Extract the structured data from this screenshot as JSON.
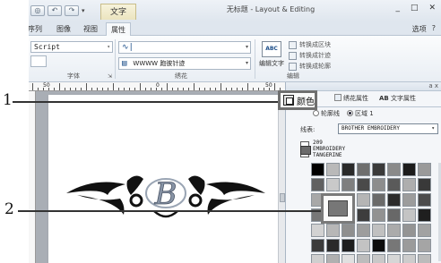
{
  "callouts": {
    "one": "1",
    "two": "2"
  },
  "title_bar": {
    "contextual_tab": "文字",
    "title": "无标题 - Layout & Editing",
    "minimize": "_",
    "maximize": "□",
    "close": "✕",
    "dropdown": "▾"
  },
  "tabs": {
    "items": [
      "序列",
      "图像",
      "视图",
      "属性"
    ],
    "right": [
      "选项",
      "?"
    ]
  },
  "ribbon": {
    "font_name": "Script",
    "font_group": "字体",
    "pattern_row1": "",
    "pattern_row2": "WWWW 跑彼针迹",
    "pattern_glyph1": "∿|",
    "pattern_glyph2": "▤",
    "stitch_group": "绣花",
    "edit_text_label": "编辑文字",
    "edit_text_icon_text": "ABC",
    "insert_items": [
      "转换成区块",
      "转换成针迹",
      "转换成轮廓"
    ],
    "edit_group": "编辑"
  },
  "ruler": {
    "labels": [
      "50",
      "0",
      "50"
    ]
  },
  "panel": {
    "close": "a x",
    "tab_color": "颜色",
    "tab_stitch": "绣花属性",
    "tab_text_prefix": "AB",
    "tab_text": "文字属性",
    "radio_outline": "轮廓线",
    "radio_region": "区域 1",
    "thread_label": "线表:",
    "thread_value": "BROTHER EMBROIDERY",
    "thread_info": [
      "209",
      "EMBROIDERY",
      "TANGERINE"
    ]
  },
  "colors": {
    "ribbon_bg": "#e9eef4",
    "tab_active_bg": "#f7f9fb",
    "contextual_tab_bg": "#ebe4bf",
    "canvas_gray": "#a9aeb5",
    "selected_color": "#777777"
  },
  "swatches": [
    "#000000",
    "#b9b9b9",
    "#2a2a2a",
    "#6e6e6e",
    "#3a3a3a",
    "#8a8a8a",
    "#1c1c1c",
    "#9a9a9a",
    "#606060",
    "#c9c9c9",
    "#7f7f7f",
    "#4a4a4a",
    "#8d8d8d",
    "#5a5a5a",
    "#aeaeae",
    "#393939",
    "#a8a8a8",
    "#7a7a7a",
    "#555555",
    "#b5b5b5",
    "#6a6a6a",
    "#2c2c2c",
    "#9c9c9c",
    "#4c4c4c",
    "#777777",
    "#b0b0b0",
    "#bdbdbd",
    "#3d3d3d",
    "#929292",
    "#686868",
    "#c4c4c4",
    "#1f1f1f",
    "#d2d2d2",
    "#b7b7b7",
    "#8f8f8f",
    "#9d9d9d",
    "#c0c0c0",
    "#ababab",
    "#949494",
    "#a2a2a2",
    "#3b3b3b",
    "#2a2a2a",
    "#1e1e1e",
    "#c3c3c3",
    "#0d0d0d",
    "#777777",
    "#9b9b9b",
    "#a5a5a5",
    "#cfcfcf",
    "#b0b0b0",
    "#e0e0e0",
    "#bcbcbc",
    "#c8c8c8",
    "#d6d6d6",
    "#cccccc",
    "#bbbbbb"
  ],
  "embroidery": {
    "letter": "B"
  }
}
